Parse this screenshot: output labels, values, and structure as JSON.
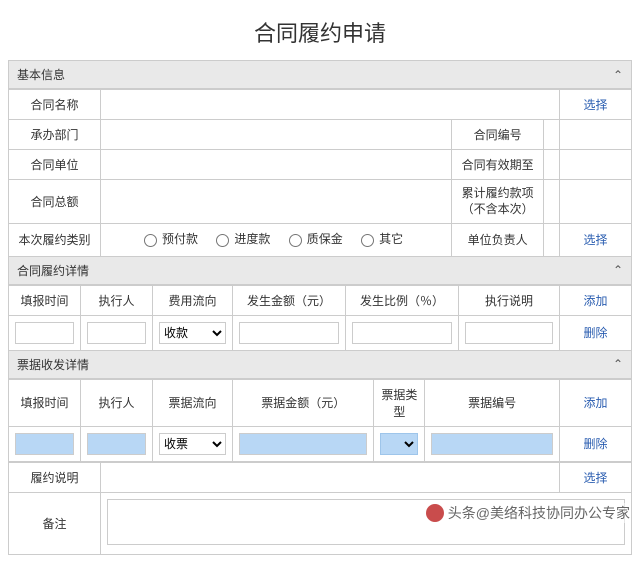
{
  "title": "合同履约申请",
  "sections": {
    "basic": "基本信息",
    "perform": "合同履约详情",
    "invoice": "票据收发详情"
  },
  "basic": {
    "contract_name": "合同名称",
    "dept": "承办部门",
    "contract_no": "合同编号",
    "unit": "合同单位",
    "valid_until": "合同有效期至",
    "total": "合同总额",
    "accum": "累计履约款项（不含本次）",
    "category_label": "本次履约类别",
    "options": {
      "prepay": "预付款",
      "progress": "进度款",
      "quality": "质保金",
      "other": "其它"
    },
    "unit_owner": "单位负责人",
    "select": "选择"
  },
  "perform": {
    "headers": {
      "time": "填报时间",
      "executor": "执行人",
      "flow": "费用流向",
      "amount": "发生金额（元）",
      "ratio": "发生比例（％）",
      "note": "执行说明"
    },
    "flow_option": "收款",
    "add": "添加",
    "del": "删除"
  },
  "invoice": {
    "headers": {
      "time": "填报时间",
      "executor": "执行人",
      "flow": "票据流向",
      "amount": "票据金额（元）",
      "type": "票据类型",
      "no": "票据编号"
    },
    "flow_option": "收票",
    "add": "添加",
    "del": "删除"
  },
  "tail": {
    "note_label": "履约说明",
    "select": "选择",
    "remark_label": "备注"
  },
  "watermark": "头条@美络科技协同办公专家"
}
